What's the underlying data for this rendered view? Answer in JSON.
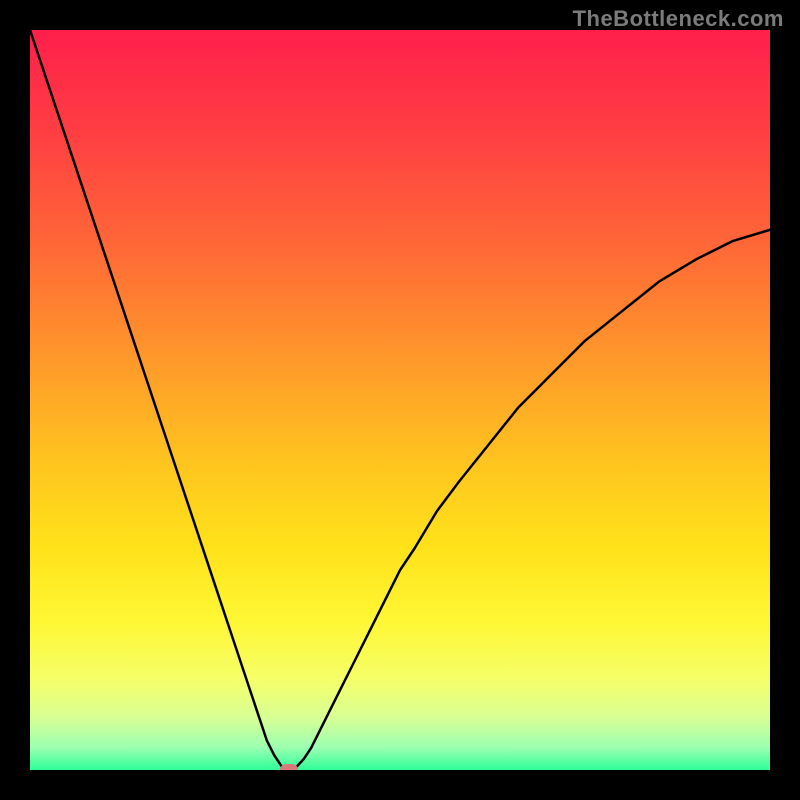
{
  "watermark": "TheBottleneck.com",
  "chart_data": {
    "type": "line",
    "title": "",
    "xlabel": "",
    "ylabel": "",
    "xlim": [
      0,
      100
    ],
    "ylim": [
      0,
      100
    ],
    "grid": false,
    "legend": false,
    "x": [
      0,
      2,
      4,
      6,
      8,
      10,
      12,
      14,
      16,
      18,
      20,
      22,
      24,
      26,
      28,
      30,
      31,
      32,
      33,
      34,
      35,
      36,
      37,
      38,
      40,
      42,
      44,
      46,
      48,
      50,
      52,
      55,
      58,
      62,
      66,
      70,
      75,
      80,
      85,
      90,
      95,
      100
    ],
    "values": [
      100,
      94,
      88,
      82,
      76,
      70,
      64,
      58,
      52,
      46,
      40,
      34,
      28,
      22,
      16,
      10,
      7,
      4,
      2,
      0.5,
      0,
      0.4,
      1.5,
      3,
      7,
      11,
      15,
      19,
      23,
      27,
      30,
      35,
      39,
      44,
      49,
      53,
      58,
      62,
      66,
      69,
      71.5,
      73
    ],
    "marker": {
      "x": 35,
      "y": 0
    },
    "background_gradient_stops": [
      {
        "offset": 0.0,
        "color": "#ff1f4b"
      },
      {
        "offset": 0.15,
        "color": "#ff4142"
      },
      {
        "offset": 0.3,
        "color": "#ff6a36"
      },
      {
        "offset": 0.45,
        "color": "#ff9a2a"
      },
      {
        "offset": 0.58,
        "color": "#ffc31f"
      },
      {
        "offset": 0.7,
        "color": "#ffe21a"
      },
      {
        "offset": 0.8,
        "color": "#fff735"
      },
      {
        "offset": 0.88,
        "color": "#f5ff6a"
      },
      {
        "offset": 0.93,
        "color": "#d7ff96"
      },
      {
        "offset": 0.97,
        "color": "#9affb0"
      },
      {
        "offset": 1.0,
        "color": "#2fff9a"
      }
    ]
  }
}
